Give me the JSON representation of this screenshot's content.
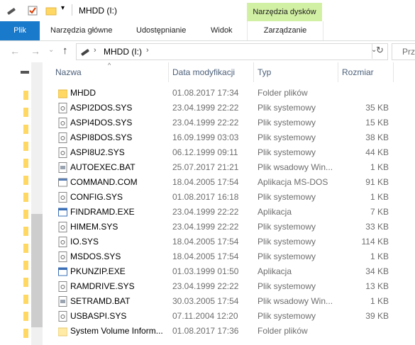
{
  "window": {
    "title": "MHDD (I:)",
    "context_tab_group": "Narzędzia dysków"
  },
  "ribbon": {
    "tabs": [
      "Plik",
      "Narzędzia główne",
      "Udostępnianie",
      "Widok",
      "Zarządzanie"
    ]
  },
  "address": {
    "path": "MHDD (I:)",
    "search_placeholder": "Prze"
  },
  "columns": {
    "name": "Nazwa",
    "date": "Data modyfikacji",
    "type": "Typ",
    "size": "Rozmiar"
  },
  "files": [
    {
      "name": "MHDD",
      "date": "01.08.2017 17:34",
      "type": "Folder plików",
      "size": "",
      "icon": "folder-icon"
    },
    {
      "name": "ASPI2DOS.SYS",
      "date": "23.04.1999 22:22",
      "type": "Plik systemowy",
      "size": "35 KB",
      "icon": "system-file-icon"
    },
    {
      "name": "ASPI4DOS.SYS",
      "date": "23.04.1999 22:22",
      "type": "Plik systemowy",
      "size": "15 KB",
      "icon": "system-file-icon"
    },
    {
      "name": "ASPI8DOS.SYS",
      "date": "16.09.1999 03:03",
      "type": "Plik systemowy",
      "size": "38 KB",
      "icon": "system-file-icon"
    },
    {
      "name": "ASPI8U2.SYS",
      "date": "06.12.1999 09:11",
      "type": "Plik systemowy",
      "size": "44 KB",
      "icon": "system-file-icon"
    },
    {
      "name": "AUTOEXEC.BAT",
      "date": "25.07.2017 21:21",
      "type": "Plik wsadowy Win...",
      "size": "1 KB",
      "icon": "batch-file-icon"
    },
    {
      "name": "COMMAND.COM",
      "date": "18.04.2005 17:54",
      "type": "Aplikacja MS-DOS",
      "size": "91 KB",
      "icon": "dos-app-icon"
    },
    {
      "name": "CONFIG.SYS",
      "date": "01.08.2017 16:18",
      "type": "Plik systemowy",
      "size": "1 KB",
      "icon": "system-file-icon"
    },
    {
      "name": "FINDRAMD.EXE",
      "date": "23.04.1999 22:22",
      "type": "Aplikacja",
      "size": "7 KB",
      "icon": "application-icon"
    },
    {
      "name": "HIMEM.SYS",
      "date": "23.04.1999 22:22",
      "type": "Plik systemowy",
      "size": "33 KB",
      "icon": "system-file-icon"
    },
    {
      "name": "IO.SYS",
      "date": "18.04.2005 17:54",
      "type": "Plik systemowy",
      "size": "114 KB",
      "icon": "system-file-icon"
    },
    {
      "name": "MSDOS.SYS",
      "date": "18.04.2005 17:54",
      "type": "Plik systemowy",
      "size": "1 KB",
      "icon": "system-file-icon"
    },
    {
      "name": "PKUNZIP.EXE",
      "date": "01.03.1999 01:50",
      "type": "Aplikacja",
      "size": "34 KB",
      "icon": "application-icon"
    },
    {
      "name": "RAMDRIVE.SYS",
      "date": "23.04.1999 22:22",
      "type": "Plik systemowy",
      "size": "13 KB",
      "icon": "system-file-icon"
    },
    {
      "name": "SETRAMD.BAT",
      "date": "30.03.2005 17:54",
      "type": "Plik wsadowy Win...",
      "size": "1 KB",
      "icon": "batch-file-icon"
    },
    {
      "name": "USBASPI.SYS",
      "date": "07.11.2004 12:20",
      "type": "Plik systemowy",
      "size": "39 KB",
      "icon": "system-file-icon"
    },
    {
      "name": "System Volume Inform...",
      "date": "01.08.2017 17:36",
      "type": "Folder plików",
      "size": "",
      "icon": "folder-icon"
    }
  ]
}
